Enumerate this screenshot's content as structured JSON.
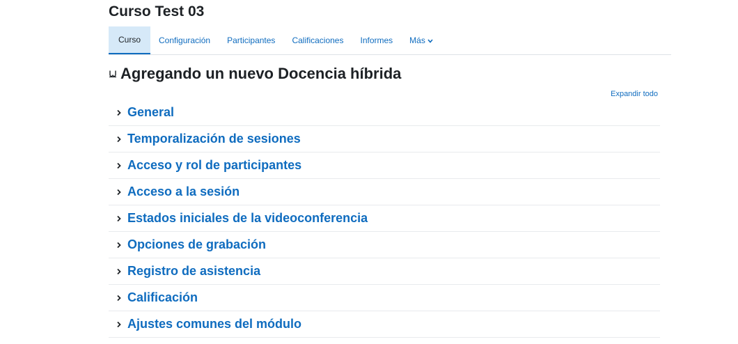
{
  "course": {
    "title": "Curso Test 03"
  },
  "nav": {
    "items": [
      {
        "label": "Curso",
        "active": true
      },
      {
        "label": "Configuración",
        "active": false
      },
      {
        "label": "Participantes",
        "active": false
      },
      {
        "label": "Calificaciones",
        "active": false
      },
      {
        "label": "Informes",
        "active": false
      },
      {
        "label": "Más",
        "active": false
      }
    ]
  },
  "page": {
    "heading": "Agregando un nuevo Docencia híbrida",
    "heading_icon": "bigbluebutton-icon",
    "expand_all": "Expandir todo"
  },
  "sections": [
    {
      "label": "General"
    },
    {
      "label": "Temporalización de sesiones"
    },
    {
      "label": "Acceso y rol de participantes"
    },
    {
      "label": "Acceso a la sesión"
    },
    {
      "label": "Estados iniciales de la videoconferencia"
    },
    {
      "label": "Opciones de grabación"
    },
    {
      "label": "Registro de asistencia"
    },
    {
      "label": "Calificación"
    },
    {
      "label": "Ajustes comunes del módulo"
    }
  ],
  "colors": {
    "link": "#0f6cbf",
    "active_tab_bg": "#d6e9f8",
    "text": "#1d2125"
  }
}
